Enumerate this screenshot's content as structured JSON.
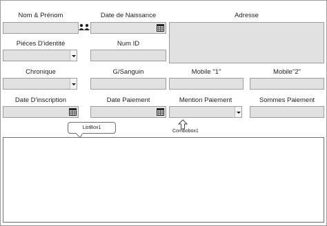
{
  "labels": {
    "nom_prenom": "Nom & Prénom",
    "date_naissance": "Date de Naissance",
    "adresse": "Adresse",
    "pieces_identite": "Piéces D'identité",
    "num_id": "Num ID",
    "chronique": "Chronique",
    "gs_sanguin": "G/Sanguin",
    "mobile1": "Mobile \"1\"",
    "mobile2": "Mobile\"2\"",
    "date_inscription": "Date D'inscription",
    "date_paiement": "Date Paiement",
    "mention_paiement": "Mention Paiement",
    "sommes_paiement": "Sommes Paiement"
  },
  "annotations": {
    "listbox_callout": "ListBox1",
    "combobox_label": "Combobox1"
  },
  "colors": {
    "field_bg": "#e1e1e1",
    "field_border": "#9c9c9c"
  },
  "icons": [
    "people-icon",
    "calendar-icon",
    "chevron-down-icon",
    "arrow-up-icon"
  ]
}
